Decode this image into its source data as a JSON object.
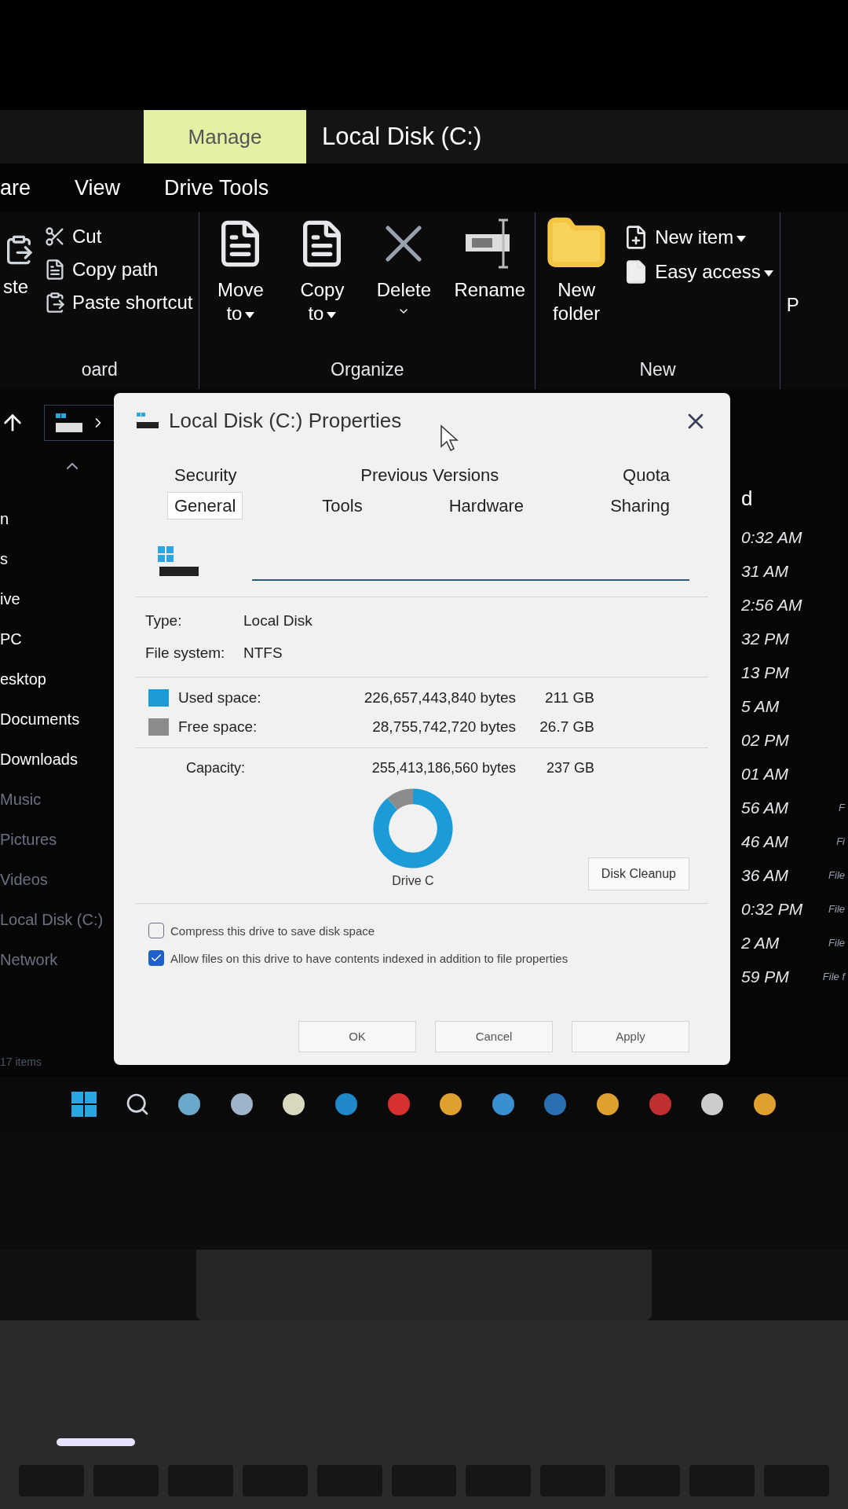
{
  "explorer": {
    "context_tab": "Manage",
    "title": "Local Disk (C:)",
    "ribbon_tabs": [
      {
        "label": "are",
        "selected": false
      },
      {
        "label": "View",
        "selected": false
      },
      {
        "label": "Drive Tools",
        "selected": false
      }
    ],
    "groups": [
      {
        "label": "oard",
        "items": [
          {
            "kind": "paste",
            "label": "ste"
          },
          {
            "kind": "cut",
            "label": "Cut"
          },
          {
            "kind": "copy_path",
            "label": "Copy path"
          },
          {
            "kind": "paste_shortcut",
            "label": "Paste shortcut"
          }
        ]
      },
      {
        "label": "Organize",
        "items": [
          {
            "kind": "move_to",
            "label": "Move to",
            "dropdown": true
          },
          {
            "kind": "copy_to",
            "label": "Copy to",
            "dropdown": true
          },
          {
            "kind": "delete",
            "label": "Delete"
          },
          {
            "kind": "rename",
            "label": "Rename"
          }
        ]
      },
      {
        "label": "New",
        "items": [
          {
            "kind": "new_folder",
            "label": "New folder"
          },
          {
            "kind": "new_item",
            "label": "New item",
            "dropdown": true
          },
          {
            "kind": "easy_access",
            "label": "Easy access",
            "dropdown": true
          }
        ]
      }
    ],
    "cut_group_label": "P",
    "sidebar": [
      "n",
      "s",
      "ive",
      "PC",
      "esktop",
      "Documents",
      "Downloads",
      "Music",
      "Pictures",
      "Videos",
      "Local Disk (C:)",
      "Network"
    ],
    "column_header": "d",
    "rows": [
      {
        "time": "0:32 AM"
      },
      {
        "time": "31 AM"
      },
      {
        "time": "2:56 AM"
      },
      {
        "time": "32 PM"
      },
      {
        "time": "13 PM"
      },
      {
        "time": "5 AM"
      },
      {
        "time": "02 PM"
      },
      {
        "time": "01 AM"
      },
      {
        "time": "56 AM",
        "type": "F"
      },
      {
        "time": "46 AM",
        "type": "Fi"
      },
      {
        "time": "36 AM",
        "type": "File"
      },
      {
        "time": "0:32 PM",
        "type": "File"
      },
      {
        "time": "2 AM",
        "type": "File"
      },
      {
        "time": "59 PM",
        "type": "File f"
      }
    ],
    "status": "17 items"
  },
  "dialog": {
    "title": "Local Disk (C:) Properties",
    "tab_rows": [
      [
        {
          "label": "Security",
          "selected": false
        },
        {
          "label": "Previous Versions",
          "selected": false
        },
        {
          "label": "Quota",
          "selected": false
        }
      ],
      [
        {
          "label": "General",
          "selected": true
        },
        {
          "label": "Tools",
          "selected": false
        },
        {
          "label": "Hardware",
          "selected": false
        },
        {
          "label": "Sharing",
          "selected": false
        }
      ]
    ],
    "info": [
      {
        "label": "Type:",
        "value": "Local Disk"
      },
      {
        "label": "File system:",
        "value": "NTFS"
      }
    ],
    "space": [
      {
        "label": "Used space:",
        "bytes": "226,657,443,840 bytes",
        "size": "211 GB",
        "color": "#1b9bd7"
      },
      {
        "label": "Free space:",
        "bytes": "28,755,742,720 bytes",
        "size": "26.7 GB",
        "color": "#8c8c8c"
      }
    ],
    "capacity": {
      "label": "Capacity:",
      "bytes": "255,413,186,560 bytes",
      "size": "237 GB"
    },
    "chart_data": {
      "type": "donut",
      "values": [
        88.8,
        11.2
      ]
    },
    "drive_label": "Drive C",
    "cleanup_button": "Disk Cleanup",
    "options": [
      {
        "label": "Compress this drive to save disk space",
        "checked": false
      },
      {
        "label": "Allow files on this drive to have contents indexed in addition to file properties",
        "checked": true
      }
    ],
    "buttons": [
      "OK",
      "Cancel",
      "Apply"
    ]
  }
}
